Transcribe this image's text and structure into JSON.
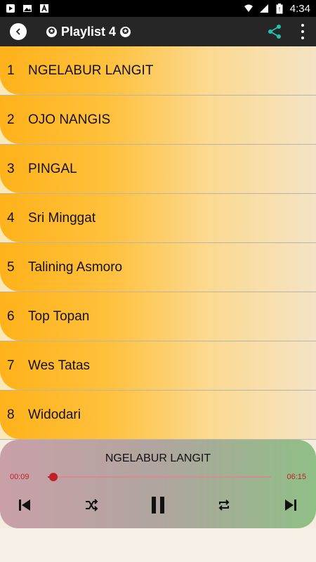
{
  "status_bar": {
    "time": "4:34"
  },
  "app_bar": {
    "title": "Playlist 4"
  },
  "playlist": [
    {
      "num": "1",
      "title": "NGELABUR LANGIT"
    },
    {
      "num": "2",
      "title": "OJO NANGIS"
    },
    {
      "num": "3",
      "title": "PINGAL"
    },
    {
      "num": "4",
      "title": "Sri Minggat"
    },
    {
      "num": "5",
      "title": "Talining Asmoro"
    },
    {
      "num": "6",
      "title": "Top Topan"
    },
    {
      "num": "7",
      "title": "Wes Tatas"
    },
    {
      "num": "8",
      "title": "Widodari"
    }
  ],
  "player": {
    "title": "NGELABUR LANGIT",
    "current_time": "00:09",
    "duration": "06:15",
    "progress": 0.024
  },
  "colors": {
    "accent": "#c0202a",
    "row_orange": "#ffb21a",
    "app_bar": "#262626",
    "share": "#1fc3b0"
  }
}
